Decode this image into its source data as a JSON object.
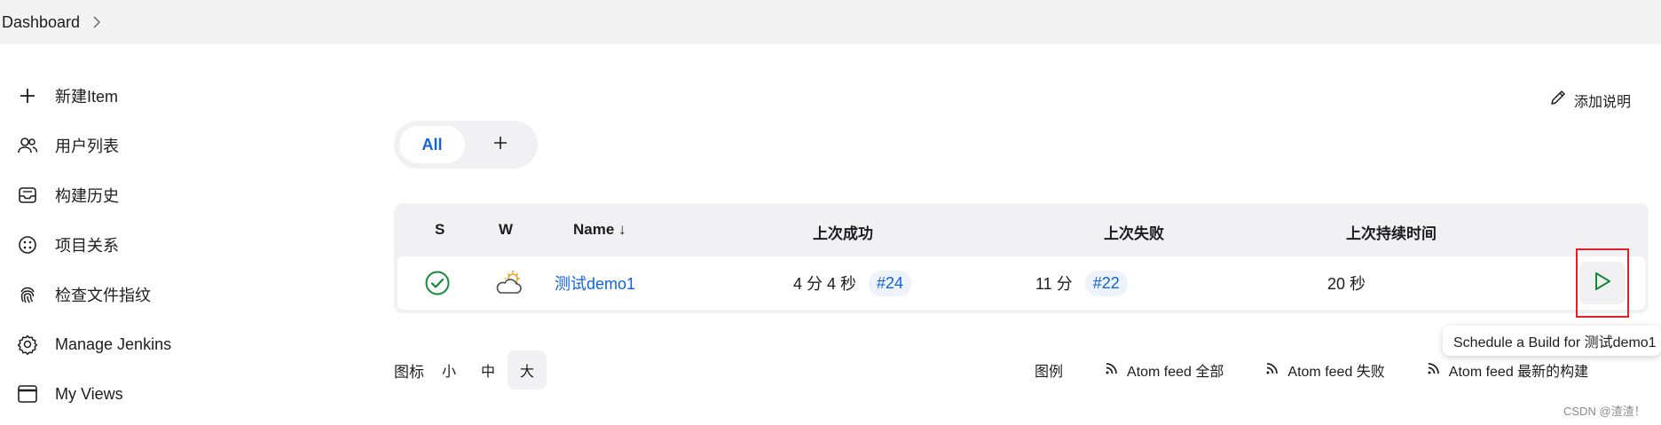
{
  "breadcrumb": {
    "item": "Dashboard"
  },
  "sidebar": {
    "items": [
      {
        "label": "新建Item",
        "icon": "plus-icon"
      },
      {
        "label": "用户列表",
        "icon": "users-icon"
      },
      {
        "label": "构建历史",
        "icon": "inbox-icon"
      },
      {
        "label": "项目关系",
        "icon": "relationship-icon"
      },
      {
        "label": "检查文件指纹",
        "icon": "fingerprint-icon"
      },
      {
        "label": "Manage Jenkins",
        "icon": "gear-icon"
      },
      {
        "label": "My Views",
        "icon": "window-icon"
      }
    ]
  },
  "description": {
    "add_label": "添加说明"
  },
  "views": {
    "tabs": [
      {
        "label": "All"
      }
    ],
    "add_icon": "plus-icon"
  },
  "table": {
    "headers": {
      "s": "S",
      "w": "W",
      "name": "Name ↓",
      "last_success": "上次成功",
      "last_failure": "上次失败",
      "last_duration": "上次持续时间"
    },
    "rows": [
      {
        "status_icon": "success-check-icon",
        "weather_icon": "partly-cloudy-icon",
        "name": "测试demo1",
        "last_success": "4 分 4 秒",
        "last_success_build": "#24",
        "last_failure": "11 分",
        "last_failure_build": "#22",
        "last_duration": "20 秒"
      }
    ]
  },
  "tooltip": {
    "text": "Schedule a Build for 测试demo1"
  },
  "icon_size": {
    "label": "图标",
    "options": [
      "小",
      "中",
      "大"
    ],
    "selected": "大"
  },
  "footer": {
    "legend": "图例",
    "feeds": [
      "Atom feed 全部",
      "Atom feed 失败",
      "Atom feed 最新的构建"
    ]
  },
  "watermark": "CSDN @渣渣！",
  "colors": {
    "link": "#1263d9",
    "success": "#138a36",
    "highlight_border": "#e0202a"
  }
}
